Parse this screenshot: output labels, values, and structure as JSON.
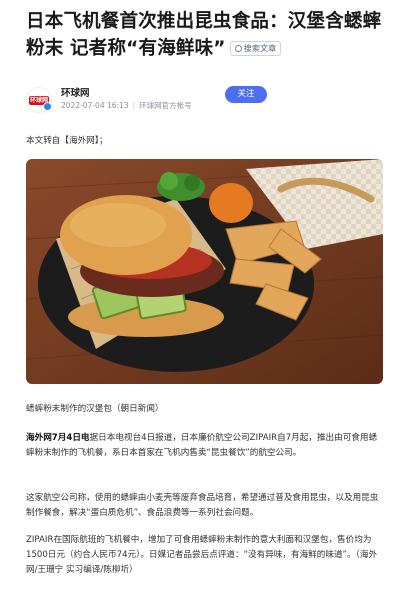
{
  "article": {
    "title": "日本飞机餐首次推出昆虫食品：汉堡含蟋蟀粉末 记者称“有海鲜味”",
    "summary_label": "搜索文章"
  },
  "author": {
    "name": "环球网",
    "avatar_text": "环球网",
    "date": "2022-07-04 16:13",
    "desc": "环球网官方帐号",
    "follow_label": "关注"
  },
  "body": {
    "source_note": "本文转自【海外网】；",
    "photo_alt": "蟋蟀粉末制作的汉堡包",
    "caption": "蟋蟀粉末制作的汉堡包（朝日新闻）",
    "para1_lead": "海外网7月4日电",
    "para1_rest": "据日本电视台4日报道，日本廉价航空公司ZIPAIR自7月起，推出由可食用蟋蟀粉末制作的飞机餐，系日本首家在飞机内售卖“昆虫餐饮”的航空公司。",
    "para2": "这家航空公司称，使用的蟋蟀由小麦壳等废弃食品培育，希望通过普及食用昆虫，以及用昆虫制作餐食，解决“蛋白质危机”、食品浪费等一系列社会问题。",
    "para3": "ZIPAIR在国际航班的飞机餐中，增加了可食用蟋蟀粉末制作的意大利面和汉堡包，售价均为1500日元（约合人民币74元）。日媒记者品尝后点评道：“没有异味，有海鲜的味道”。（海外网/王珊宁 实习编译/陈柳圻）"
  },
  "colors": {
    "accent": "#4e6ef2",
    "logo_red": "#d0121b",
    "verify_blue": "#2b80ff"
  }
}
